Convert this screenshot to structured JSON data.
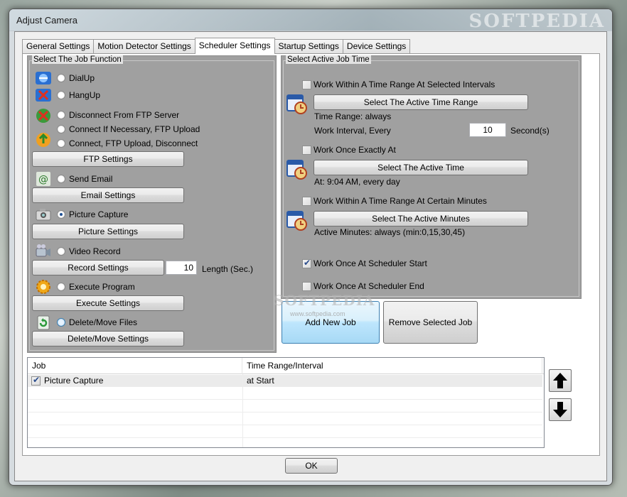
{
  "window": {
    "title": "Adjust Camera",
    "watermark": "SOFTPEDIA"
  },
  "tabs": [
    {
      "label": "General Settings"
    },
    {
      "label": "Motion Detector Settings"
    },
    {
      "label": "Scheduler Settings"
    },
    {
      "label": "Startup Settings"
    },
    {
      "label": "Device Settings"
    }
  ],
  "job_function": {
    "title": "Select The Job Function",
    "options": {
      "dialup": "DialUp",
      "hangup": "HangUp",
      "disconnect_ftp": "Disconnect From FTP Server",
      "connect_ftp_upload": "Connect If Necessary, FTP Upload",
      "connect_upload_disconnect": "Connect, FTP Upload, Disconnect",
      "send_email": "Send Email",
      "picture_capture": "Picture Capture",
      "video_record": "Video Record",
      "execute_program": "Execute Program",
      "delete_move": "Delete/Move Files"
    },
    "selected": "Picture Capture",
    "buttons": {
      "ftp_settings": "FTP Settings",
      "email_settings": "Email Settings",
      "picture_settings": "Picture Settings",
      "record_settings": "Record Settings",
      "execute_settings": "Execute Settings",
      "delete_move_settings": "Delete/Move Settings"
    },
    "record_length_value": "10",
    "record_length_label": "Length (Sec.)"
  },
  "active_time": {
    "title": "Select Active Job Time",
    "range_intervals": {
      "checkbox_label": "Work Within A Time Range At Selected Intervals",
      "checked": false,
      "button": "Select The Active Time Range",
      "time_range_text": "Time Range: always",
      "interval_label": "Work Interval, Every",
      "interval_value": "10",
      "interval_unit": "Second(s)"
    },
    "once_exactly": {
      "checkbox_label": "Work Once Exactly At",
      "checked": false,
      "button": "Select The Active Time",
      "info": "At: 9:04 AM, every day"
    },
    "certain_minutes": {
      "checkbox_label": "Work Within A Time Range At Certain Minutes",
      "checked": false,
      "button": "Select The Active Minutes",
      "info": "Active Minutes: always (min:0,15,30,45)"
    },
    "scheduler_start": {
      "checkbox_label": "Work Once At Scheduler Start",
      "checked": true
    },
    "scheduler_end": {
      "checkbox_label": "Work Once At Scheduler End",
      "checked": false
    }
  },
  "job_buttons": {
    "add": "Add New Job",
    "remove": "Remove Selected Job"
  },
  "watermark_url": "www.softpedia.com",
  "job_table": {
    "columns": [
      "Job",
      "Time Range/Interval"
    ],
    "rows": [
      {
        "job": "Picture Capture",
        "interval": "at Start",
        "checked": true
      }
    ]
  },
  "ok_label": "OK",
  "colors": {
    "panel_bg": "#a0a0a0",
    "accent": "#1c4f94"
  }
}
